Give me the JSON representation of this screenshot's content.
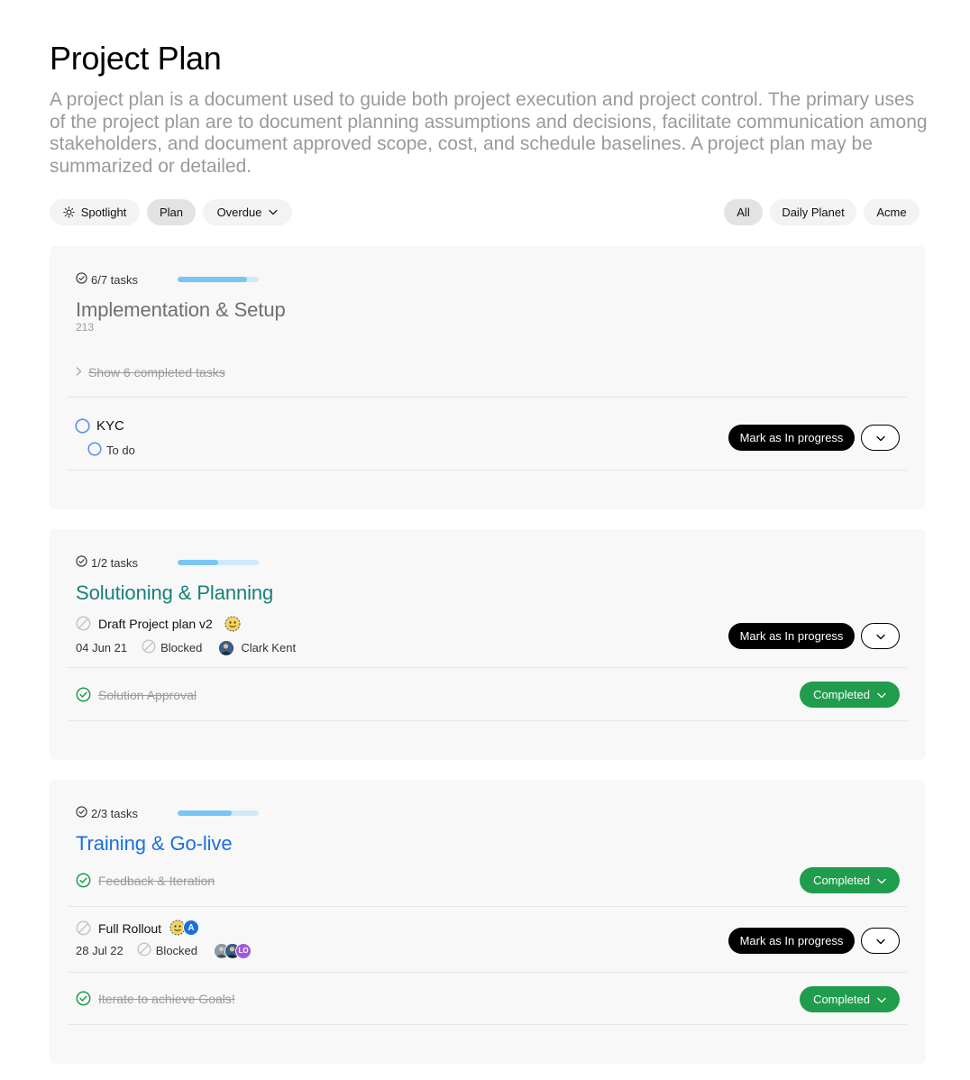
{
  "page": {
    "title": "Project Plan",
    "description": "A project plan is a document used to guide both project execution and project control. The primary uses of the project plan are to document planning assumptions and decisions, facilitate communication among stakeholders, and document approved scope, cost, and schedule baselines. A project plan may be summarized or detailed."
  },
  "filters": {
    "left": [
      {
        "label": "Spotlight",
        "icon": "sun-icon",
        "active": false
      },
      {
        "label": "Plan",
        "active": true
      },
      {
        "label": "Overdue",
        "icon": "chevron-down-icon",
        "active": false
      }
    ],
    "right": [
      {
        "label": "All",
        "active": true
      },
      {
        "label": "Daily Planet",
        "active": false
      },
      {
        "label": "Acme",
        "active": false
      }
    ]
  },
  "colors": {
    "accent_teal": "#1a7f7a",
    "accent_blue": "#1b6fe0",
    "complete_green": "#1f9d4c",
    "todo_blue": "#5b8def",
    "progress_fill": "#79c6f3",
    "progress_track": "#cfe9fb"
  },
  "sections": [
    {
      "tasks_count": "6/7 tasks",
      "progress": 0.857,
      "title": "Implementation & Setup",
      "subtitle": "213",
      "show_completed": "Show 6 completed tasks",
      "tasks": [
        {
          "name": "KYC",
          "status": "To do",
          "action": "Mark as In progress"
        }
      ]
    },
    {
      "tasks_count": "1/2 tasks",
      "progress": 0.5,
      "title": "Solutioning & Planning",
      "tasks": [
        {
          "name": "Draft Project plan v2",
          "date": "04 Jun 21",
          "status": "Blocked",
          "assignee": "Clark Kent",
          "action": "Mark as In progress"
        },
        {
          "name": "Solution Approval",
          "status": "Completed"
        }
      ]
    },
    {
      "tasks_count": "2/3 tasks",
      "progress": 0.667,
      "title": "Training & Go-live",
      "tasks": [
        {
          "name": "Feedback & Iteration",
          "status": "Completed"
        },
        {
          "name": "Full Rollout",
          "date": "28 Jul 22",
          "status": "Blocked",
          "avatar_initials": [
            "A",
            "LO"
          ],
          "action": "Mark as In progress"
        },
        {
          "name": "Iterate to achieve Goals!",
          "status": "Completed"
        }
      ]
    }
  ]
}
